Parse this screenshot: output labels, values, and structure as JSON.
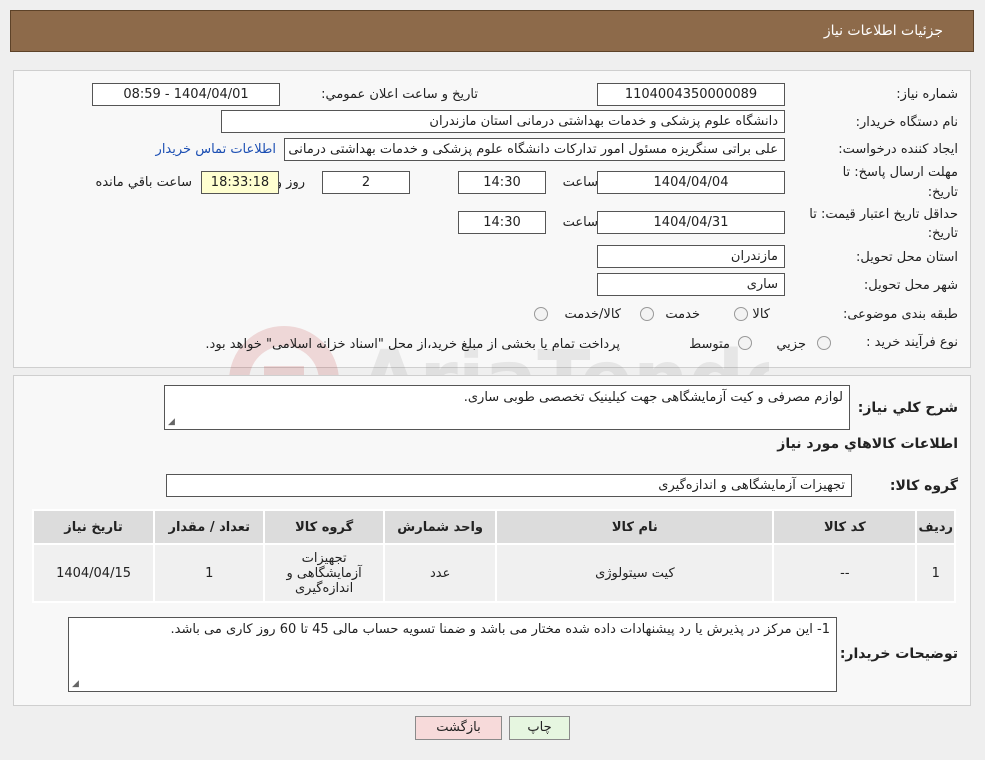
{
  "header": {
    "title": "جزئیات اطلاعات نیاز"
  },
  "form": {
    "need_number_label": "شماره نیاز:",
    "need_number": "1104004350000089",
    "announce_label": "تاریخ و ساعت اعلان عمومي:",
    "announce_value": "1404/04/01 - 08:59",
    "buyer_label": "نام دستگاه خريدار:",
    "buyer_value": "دانشگاه علوم پزشکی و خدمات بهداشتی  درمانی استان مازندران",
    "creator_label": "ايجاد کننده درخواست:",
    "creator_value": "علی براتی سنگریزه مسئول امور تدارکات دانشگاه علوم پزشکی و خدمات بهداشتی درمانی استان مازندران",
    "contact_link": "اطلاعات تماس خريدار",
    "deadline_label_1": "مهلت ارسال پاسخ: تا",
    "deadline_label_2": "تاریخ:",
    "deadline_date": "1404/04/04",
    "time_label": "ساعت",
    "deadline_time": "14:30",
    "days_value": "2",
    "days_label": "روز و",
    "remaining_time": "18:33:18",
    "remaining_label": "ساعت باقي مانده",
    "validity_label_1": "حداقل تاريخ اعتبار قيمت: تا",
    "validity_label_2": "تاريخ:",
    "validity_date": "1404/04/31",
    "validity_time": "14:30",
    "province_label": "استان محل تحويل:",
    "province_value": "مازندران",
    "city_label": "شهر محل تحويل:",
    "city_value": "ساری",
    "category_label": "طبقه بندی موضوعی:",
    "category_options": [
      "کالا",
      "خدمت",
      "کالا/خدمت"
    ],
    "process_label": "نوع فرآيند خريد :",
    "process_options": [
      "جزيي",
      "متوسط"
    ],
    "process_note": "پرداخت تمام یا بخشی از مبلغ خرید،از محل \"اسناد خزانه اسلامی\" خواهد بود."
  },
  "details": {
    "summary_label": "شرح کلي نياز:",
    "summary_value": "لوازم مصرفی و کیت آزمایشگاهی جهت کیلینیک تخصصی طوبی ساری.",
    "items_heading": "اطلاعات کالاهاي مورد نياز",
    "group_label": "گروه کالا:",
    "group_value": "تجهیزات آزمایشگاهی و اندازه‌گیری",
    "table": {
      "headers": [
        "رديف",
        "کد کالا",
        "نام کالا",
        "واحد شمارش",
        "گروه کالا",
        "تعداد / مقدار",
        "تاریخ نیاز"
      ],
      "rows": [
        [
          "1",
          "--",
          "کیت سیتولوژی",
          "عدد",
          "تجهیزات آزمایشگاهی و اندازه‌گیری",
          "1",
          "1404/04/15"
        ]
      ]
    },
    "buyer_notes_label": "توضیحات خریدار:",
    "buyer_notes_value": "1- این مرکز در پذیرش یا رد پیشنهادات داده شده مختار می باشد و ضمنا تسویه حساب مالی 45 تا 60 روز کاری می باشد."
  },
  "buttons": {
    "print": "چاپ",
    "back": "بازگشت"
  },
  "colors": {
    "header_bg": "#8d6a4a",
    "link": "#1c4fb3",
    "back_button_bg": "#f7dada",
    "print_button_bg": "#e6f6e0"
  }
}
